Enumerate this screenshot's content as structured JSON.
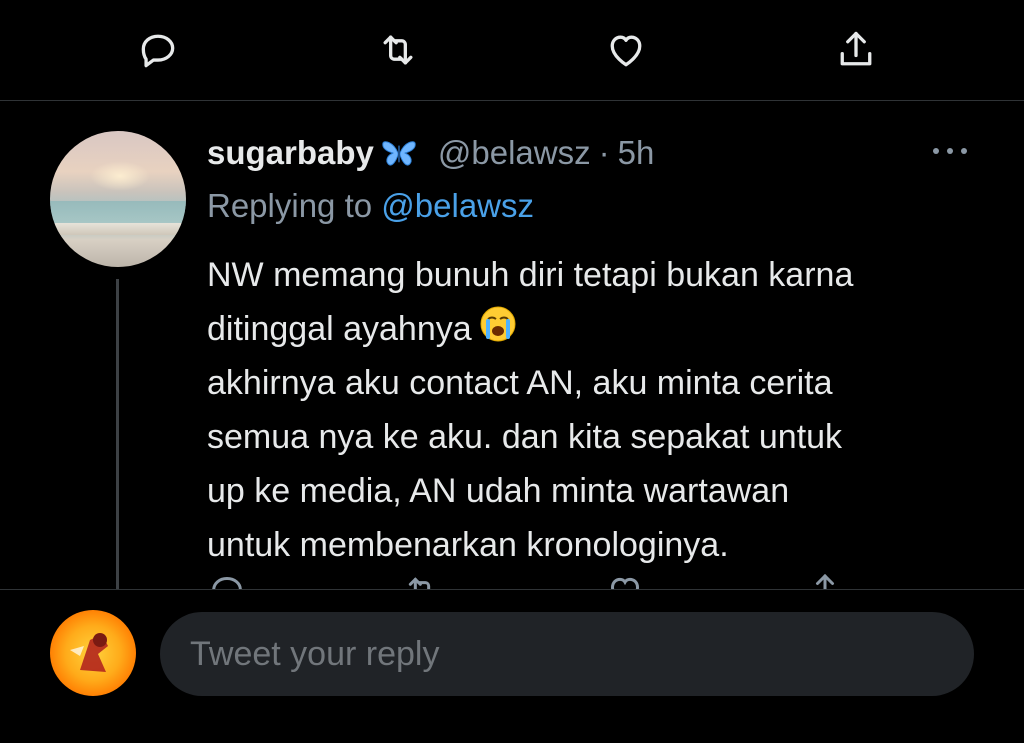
{
  "action_bar": {
    "icons": [
      "reply-icon",
      "retweet-icon",
      "like-icon",
      "share-icon"
    ]
  },
  "tweet": {
    "display_name": "sugarbaby",
    "verified_emoji": "butterfly-icon",
    "handle": "@belawsz",
    "separator": "·",
    "time": "5h",
    "replying_prefix": "Replying to",
    "replying_to": "@belawsz",
    "text_lines": [
      "NW memang bunuh diri tetapi bukan karna",
      "ditinggal ayahnya",
      "akhirnya aku contact AN, aku minta cerita",
      "semua nya ke aku. dan kita sepakat untuk",
      "up ke media, AN udah minta wartawan",
      "untuk membenarkan kronologinya."
    ],
    "emoji": "crying-face-icon"
  },
  "composer": {
    "placeholder": "Tweet your reply"
  },
  "colors": {
    "background": "#000000",
    "text": "#e7e9ea",
    "secondary": "#8b98a5",
    "link": "#4aa1e8",
    "input_bg": "#202327",
    "divider": "#2f3336"
  }
}
